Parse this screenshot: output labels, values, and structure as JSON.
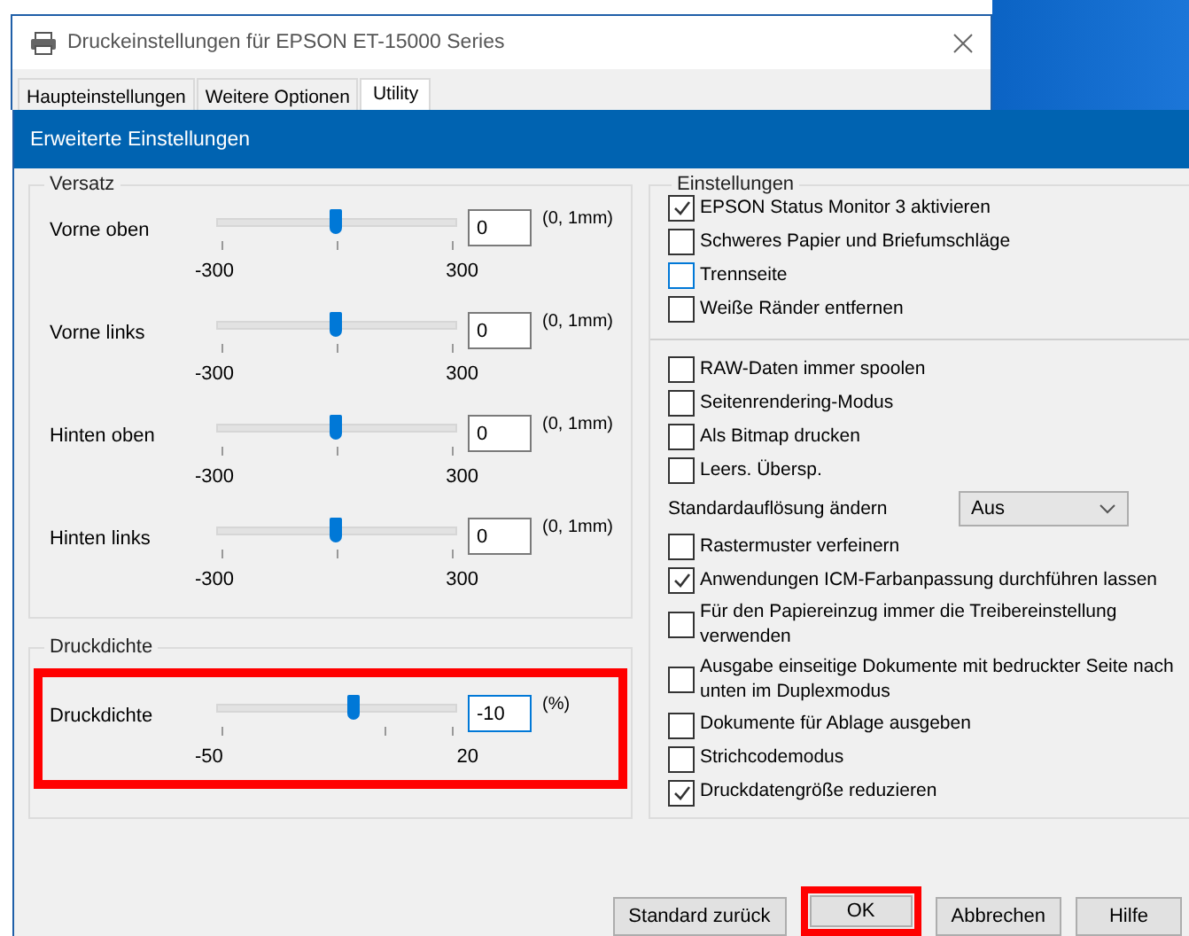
{
  "parent_window": {
    "title": "Druckeinstellungen für EPSON ET-15000 Series",
    "tabs": [
      {
        "label": "Haupteinstellungen",
        "selected": false
      },
      {
        "label": "Weitere Optionen",
        "selected": false
      },
      {
        "label": "Utility",
        "selected": true
      }
    ]
  },
  "dialog": {
    "title": "Erweiterte Einstellungen"
  },
  "offset_group": {
    "title": "Versatz",
    "rows": [
      {
        "label": "Vorne oben",
        "level": 0.5,
        "min": "-300",
        "max": "300",
        "value": "0",
        "unit": "(0, 1mm)",
        "highlighted": false,
        "focused": false
      },
      {
        "label": "Vorne links",
        "level": 0.5,
        "min": "-300",
        "max": "300",
        "value": "0",
        "unit": "(0, 1mm)",
        "highlighted": false,
        "focused": false
      },
      {
        "label": "Hinten oben",
        "level": 0.5,
        "min": "-300",
        "max": "300",
        "value": "0",
        "unit": "(0, 1mm)",
        "highlighted": false,
        "focused": false
      },
      {
        "label": "Hinten links",
        "level": 0.5,
        "min": "-300",
        "max": "300",
        "value": "0",
        "unit": "(0, 1mm)",
        "highlighted": false,
        "focused": false
      }
    ]
  },
  "density_group": {
    "title": "Druckdichte",
    "rows": [
      {
        "label": "Druckdichte",
        "level": 0.57,
        "min": "-50",
        "max": "20",
        "value": "-10",
        "unit": "(%)",
        "highlighted": true,
        "focused": true
      }
    ]
  },
  "settings_group": {
    "title": "Einstellungen",
    "items": [
      {
        "kind": "checkbox",
        "label": "EPSON Status Monitor 3 aktivieren",
        "checked": true,
        "focused": false
      },
      {
        "kind": "checkbox",
        "label": "Schweres Papier und Briefumschläge",
        "checked": false,
        "focused": false
      },
      {
        "kind": "checkbox",
        "label": "Trennseite",
        "checked": false,
        "focused": true
      },
      {
        "kind": "checkbox",
        "label": "Weiße Ränder entfernen",
        "checked": false,
        "focused": false
      },
      {
        "kind": "separator"
      },
      {
        "kind": "checkbox",
        "label": "RAW-Daten immer spoolen",
        "checked": false,
        "focused": false
      },
      {
        "kind": "checkbox",
        "label": "Seitenrendering-Modus",
        "checked": false,
        "focused": false
      },
      {
        "kind": "checkbox",
        "label": "Als Bitmap drucken",
        "checked": false,
        "focused": false
      },
      {
        "kind": "checkbox",
        "label": "Leers. Übersp.",
        "checked": false,
        "focused": false
      },
      {
        "kind": "dropdown",
        "label": "Standardauflösung ändern",
        "value": "Aus"
      },
      {
        "kind": "checkbox",
        "label": "Rastermuster verfeinern",
        "checked": false,
        "focused": false
      },
      {
        "kind": "checkbox",
        "label": "Anwendungen ICM-Farbanpassung durchführen lassen",
        "checked": true,
        "focused": false
      },
      {
        "kind": "checkbox",
        "label": "Für den Papiereinzug immer die Treibereinstellung verwenden",
        "checked": false,
        "focused": false
      },
      {
        "kind": "checkbox",
        "label": "Ausgabe einseitige Dokumente mit bedruckter Seite nach unten im Duplexmodus",
        "checked": false,
        "focused": false
      },
      {
        "kind": "checkbox",
        "label": "Dokumente für Ablage ausgeben",
        "checked": false,
        "focused": false
      },
      {
        "kind": "checkbox",
        "label": "Strichcodemodus",
        "checked": false,
        "focused": false
      },
      {
        "kind": "checkbox",
        "label": "Druckdatengröße reduzieren",
        "checked": true,
        "focused": false
      }
    ]
  },
  "buttons": [
    {
      "label": "Standard zurück",
      "highlighted": false
    },
    {
      "label": "OK",
      "highlighted": true
    },
    {
      "label": "Abbrechen",
      "highlighted": false
    },
    {
      "label": "Hilfe",
      "highlighted": false
    }
  ]
}
